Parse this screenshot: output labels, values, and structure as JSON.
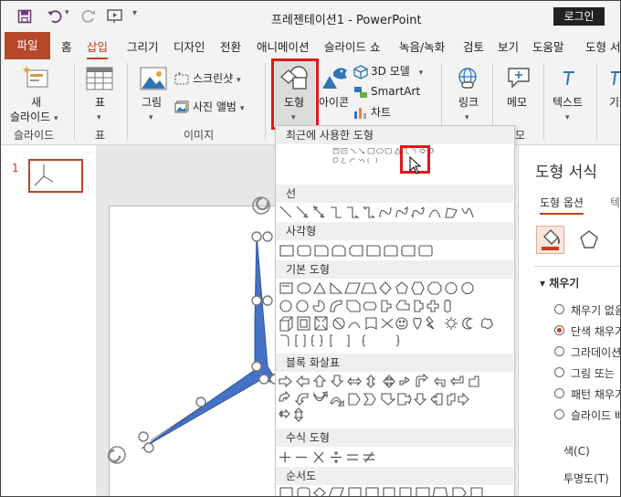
{
  "window": {
    "title": "프레젠테이션1  -  PowerPoint",
    "login_label": "로그인"
  },
  "tabs": [
    {
      "label": "파일"
    },
    {
      "label": "홈"
    },
    {
      "label": "삽입"
    },
    {
      "label": "그리기"
    },
    {
      "label": "디자인"
    },
    {
      "label": "전환"
    },
    {
      "label": "애니메이션"
    },
    {
      "label": "슬라이드 쇼"
    },
    {
      "label": "녹음/녹화"
    },
    {
      "label": "검토"
    },
    {
      "label": "보기"
    },
    {
      "label": "도움말"
    },
    {
      "label": "도형 서"
    }
  ],
  "ribbon": {
    "new_slide": [
      "새",
      "슬라이드"
    ],
    "table": "표",
    "picture": "그림",
    "screenshot": "스크린샷",
    "photo_album": "사진 앨범",
    "shapes": "도형",
    "icons": "아이콘",
    "model3d": "3D 모델",
    "smartart": "SmartArt",
    "chart": "차트",
    "link": "링크",
    "memo": "메모",
    "text": "텍스트",
    "overflow": "기",
    "groups": {
      "slides": "슬라이드",
      "tables": "표",
      "images": "이미지",
      "memo": "모"
    }
  },
  "thumbnail_number": "1",
  "shapes_menu": {
    "sections": [
      "최근에 사용한 도형",
      "선",
      "사각형",
      "기본 도형",
      "블록 화살표",
      "수식 도형",
      "순서도"
    ]
  },
  "format_pane": {
    "title": "도형 서식",
    "tabs": [
      "도형 옵션",
      "텍"
    ],
    "section": "채우기",
    "options": [
      {
        "label": "채우기 없음",
        "selected": false
      },
      {
        "label": "단색 채우기",
        "selected": true
      },
      {
        "label": "그라데이션",
        "selected": false
      },
      {
        "label": "그림 또는",
        "selected": false
      },
      {
        "label": "패턴 채우기",
        "selected": false
      },
      {
        "label": "슬라이드 배",
        "selected": false
      }
    ],
    "color_label": "색(C)",
    "transparency_label": "투명도(T)"
  },
  "colors": {
    "accent": "#c43e1c",
    "highlight": "#e0161c",
    "shape_fill": "#4472c4"
  }
}
